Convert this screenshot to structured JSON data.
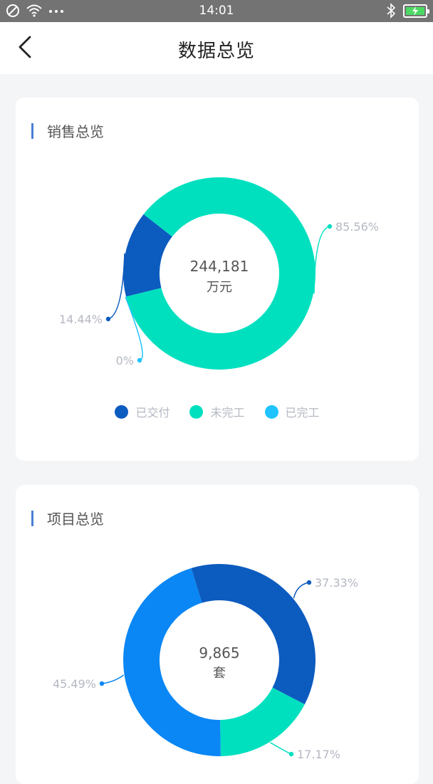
{
  "status_bar": {
    "time": "14:01",
    "icons": [
      "blocked-icon",
      "wifi-icon",
      "more-dots-icon",
      "bluetooth-icon",
      "battery-charging-icon"
    ]
  },
  "navbar": {
    "title": "数据总览",
    "back_icon": "chevron-left-icon"
  },
  "colors": {
    "dark_blue": "#0c5bbf",
    "teal": "#00e0bf",
    "sky_blue": "#1fc4ff",
    "bright_blue": "#0a87f5",
    "accent_bar": "#4a7fd3"
  },
  "sales": {
    "title": "销售总览",
    "center_value": "244,181",
    "center_unit": "万元",
    "chart_data": {
      "type": "pie",
      "style": "donut",
      "categories": [
        "已交付",
        "未完工",
        "已完工"
      ],
      "values": [
        14.44,
        85.56,
        0
      ],
      "labels": [
        "14.44%",
        "85.56%",
        "0%"
      ],
      "colors": [
        "#0c5bbf",
        "#00e0bf",
        "#1fc4ff"
      ],
      "legend": "bottom"
    }
  },
  "projects": {
    "title": "项目总览",
    "center_value": "9,865",
    "center_unit": "套",
    "chart_data": {
      "type": "pie",
      "style": "donut",
      "values": [
        37.33,
        17.17,
        45.49
      ],
      "labels": [
        "37.33%",
        "17.17%",
        "45.49%"
      ],
      "colors": [
        "#0c5bbf",
        "#00e0bf",
        "#0a87f5"
      ]
    }
  }
}
